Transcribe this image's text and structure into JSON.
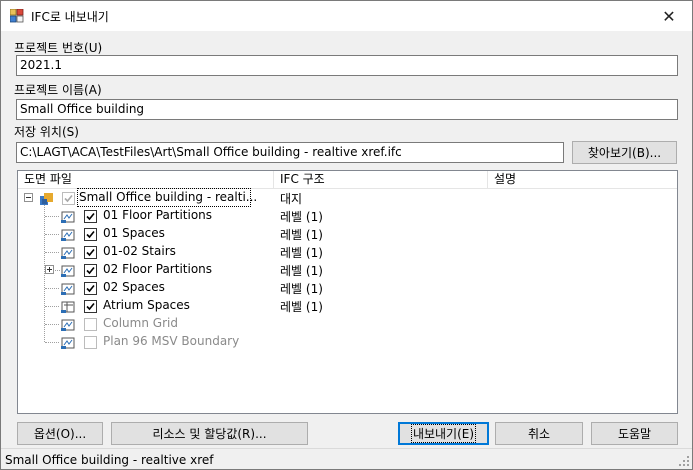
{
  "window": {
    "title": "IFC로 내보내기",
    "close_glyph": "✕"
  },
  "project_number": {
    "label": "프로젝트 번호(U)",
    "value": "2021.1"
  },
  "project_name": {
    "label": "프로젝트 이름(A)",
    "value": "Small Office building"
  },
  "save_location": {
    "label": "저장 위치(S)",
    "value": "C:\\LAGT\\ACA\\TestFiles\\Art\\Small Office building - realtive xref.ifc",
    "browse_label": "찾아보기(B)..."
  },
  "grid": {
    "columns": [
      "도면 파일",
      "IFC 구조",
      "설명"
    ],
    "root": {
      "name": "Small Office building - realti...",
      "ifc": "대지",
      "checked": true,
      "disabled": true
    },
    "rows": [
      {
        "name": "01 Floor Partitions",
        "ifc": "레벨 (1)",
        "checked": true,
        "disabled": false,
        "expandable": false
      },
      {
        "name": "01 Spaces",
        "ifc": "레벨 (1)",
        "checked": true,
        "disabled": false,
        "expandable": false
      },
      {
        "name": "01-02 Stairs",
        "ifc": "레벨 (1)",
        "checked": true,
        "disabled": false,
        "expandable": false
      },
      {
        "name": "02 Floor Partitions",
        "ifc": "레벨 (1)",
        "checked": true,
        "disabled": false,
        "expandable": true
      },
      {
        "name": "02 Spaces",
        "ifc": "레벨 (1)",
        "checked": true,
        "disabled": false,
        "expandable": false
      },
      {
        "name": "Atrium Spaces",
        "ifc": "레벨 (1)",
        "checked": true,
        "disabled": false,
        "expandable": false
      },
      {
        "name": "Column Grid",
        "ifc": "",
        "checked": false,
        "disabled": true,
        "expandable": false
      },
      {
        "name": "Plan 96 MSV Boundary",
        "ifc": "",
        "checked": false,
        "disabled": true,
        "expandable": false
      }
    ]
  },
  "buttons": {
    "options": "옵션(O)...",
    "resources": "리소스 및 할당값(R)...",
    "export": "내보내기(E)",
    "cancel": "취소",
    "help": "도움말"
  },
  "status": {
    "text": "Small Office building - realtive xref"
  },
  "icons": {
    "app": "ifc-export-app-icon",
    "drawing": "drawing-file-icon",
    "project": "project-icon"
  }
}
